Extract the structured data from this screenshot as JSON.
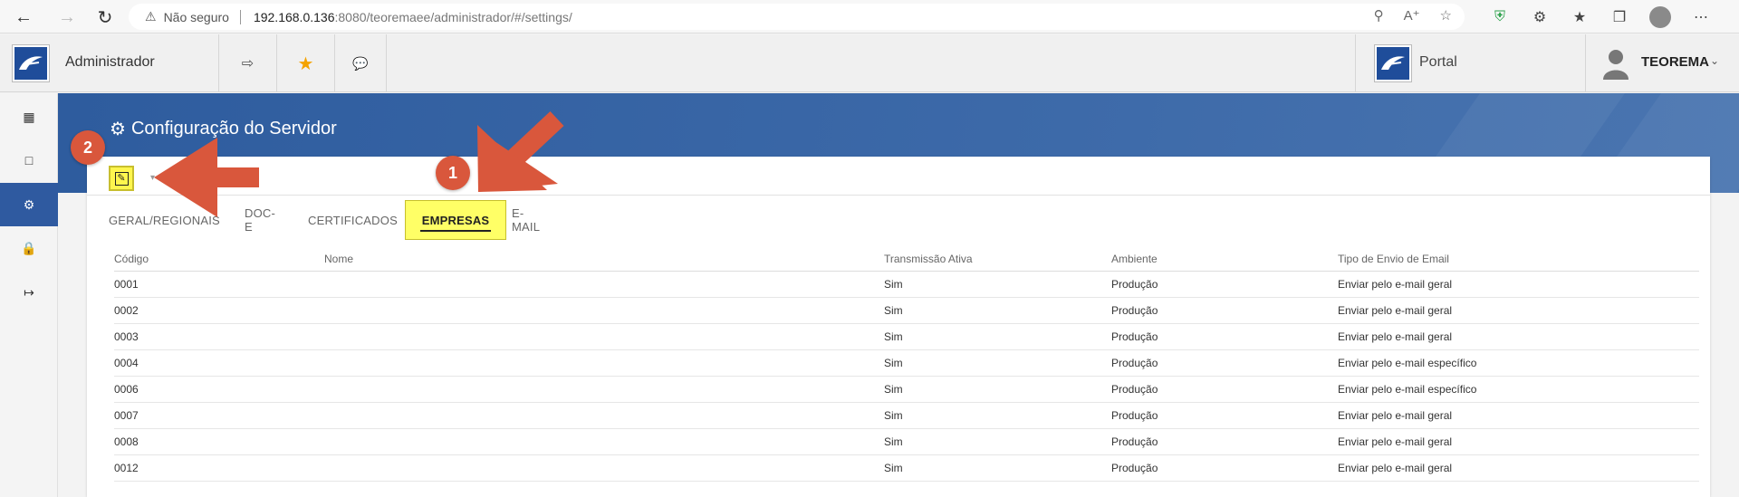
{
  "browser": {
    "security_label": "Não seguro",
    "url_host": "192.168.0.136",
    "url_rest": ":8080/teoremaee/administrador/#/settings/"
  },
  "header": {
    "app_title": "Administrador",
    "portal_label": "Portal",
    "user_name": "TEOREMA"
  },
  "page": {
    "title": "Configuração do Servidor"
  },
  "tabs": [
    {
      "label": "GERAL/REGIONAIS"
    },
    {
      "label": "DOC-E"
    },
    {
      "label": "CERTIFICADOS"
    },
    {
      "label": "EMPRESAS"
    },
    {
      "label": "E-MAIL"
    }
  ],
  "table": {
    "headers": [
      "Código",
      "Nome",
      "Transmissão Ativa",
      "Ambiente",
      "Tipo de Envio de Email"
    ],
    "rows": [
      [
        "0001",
        "",
        "Sim",
        "Produção",
        "Enviar pelo e-mail geral"
      ],
      [
        "0002",
        "",
        "Sim",
        "Produção",
        "Enviar pelo e-mail geral"
      ],
      [
        "0003",
        "",
        "Sim",
        "Produção",
        "Enviar pelo e-mail geral"
      ],
      [
        "0004",
        "",
        "Sim",
        "Produção",
        "Enviar pelo e-mail específico"
      ],
      [
        "0006",
        "",
        "Sim",
        "Produção",
        "Enviar pelo e-mail específico"
      ],
      [
        "0007",
        "",
        "Sim",
        "Produção",
        "Enviar pelo e-mail geral"
      ],
      [
        "0008",
        "",
        "Sim",
        "Produção",
        "Enviar pelo e-mail geral"
      ],
      [
        "0012",
        "",
        "Sim",
        "Produção",
        "Enviar pelo e-mail geral"
      ]
    ]
  },
  "annotations": {
    "badge_1": "1",
    "badge_2": "2"
  },
  "colors": {
    "accent": "#2f5aa0",
    "highlight": "#ffff66",
    "annotation": "#d9573c"
  },
  "icons": {
    "back": "arrow-left-icon",
    "forward": "arrow-right-icon",
    "reload": "reload-icon",
    "dashboard": "dashboard-icon",
    "messages": "chat-icon",
    "settings": "gear-icon",
    "lock": "lock-icon",
    "logout": "logout-icon",
    "edit": "edit-icon"
  }
}
